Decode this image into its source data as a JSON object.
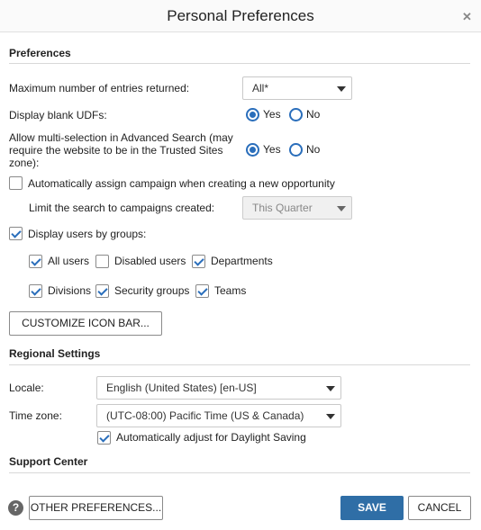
{
  "dialog": {
    "title": "Personal Preferences",
    "close_glyph": "✕"
  },
  "preferences": {
    "section_title": "Preferences",
    "max_entries": {
      "label": "Maximum number of entries returned:",
      "value": "All*"
    },
    "display_blank_udfs": {
      "label": "Display blank UDFs:",
      "yes": "Yes",
      "no": "No",
      "selected": "Yes"
    },
    "multi_selection": {
      "label_lines": [
        "Allow multi-selection in Advanced Search (may",
        "require the website to be in the Trusted Sites",
        "zone):"
      ],
      "yes": "Yes",
      "no": "No",
      "selected": "Yes"
    },
    "auto_assign_campaign": {
      "label": "Automatically assign campaign when creating a new opportunity",
      "checked": false
    },
    "limit_search": {
      "label": "Limit the search to campaigns created:",
      "value": "This Quarter",
      "disabled": true
    },
    "display_users_by_groups": {
      "label": "Display users by groups:",
      "checked": true
    },
    "groups": [
      {
        "label": "All users",
        "checked": true
      },
      {
        "label": "Disabled users",
        "checked": false
      },
      {
        "label": "Departments",
        "checked": true
      },
      {
        "label": "Divisions",
        "checked": true
      },
      {
        "label": "Security groups",
        "checked": true
      },
      {
        "label": "Teams",
        "checked": true
      }
    ],
    "customize_button": "CUSTOMIZE ICON BAR..."
  },
  "regional": {
    "section_title": "Regional Settings",
    "locale": {
      "label": "Locale:",
      "value": "English (United States) [en-US]"
    },
    "timezone": {
      "label": "Time zone:",
      "value": "(UTC-08:00) Pacific Time (US & Canada)"
    },
    "daylight_saving": {
      "label": "Automatically adjust for Daylight Saving",
      "checked": true
    }
  },
  "support": {
    "section_title": "Support Center"
  },
  "footer": {
    "help_glyph": "?",
    "other_preferences": "OTHER PREFERENCES...",
    "save": "SAVE",
    "cancel": "CANCEL"
  },
  "colors": {
    "accent": "#2a6ebb",
    "primary_button": "#2f6ea6"
  }
}
